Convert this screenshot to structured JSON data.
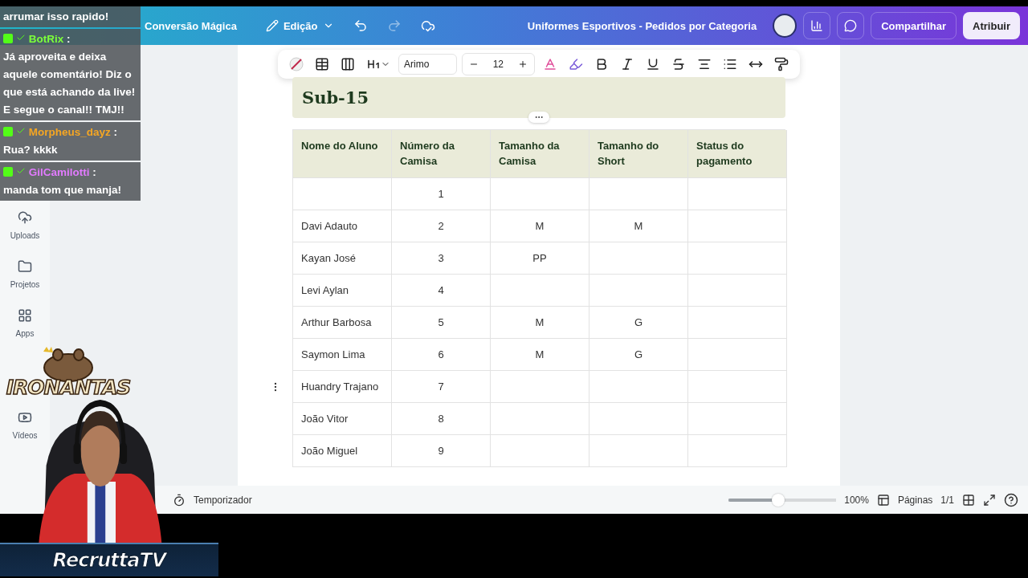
{
  "header": {
    "menu": [
      {
        "label": "Conversão Mágica"
      }
    ],
    "edit_menu": "Edição",
    "redo_disabled": true,
    "title": "Uniformes Esportivos - Pedidos por Categoria",
    "share": "Compartilhar",
    "assign": "Atribuir"
  },
  "sidebar": {
    "items": [
      {
        "kind": "upload",
        "label": "Uploads"
      },
      {
        "kind": "folder",
        "label": "Projetos"
      },
      {
        "kind": "apps",
        "label": "Apps"
      },
      {
        "kind": "video",
        "label": "Vídeos"
      }
    ]
  },
  "toolbar": {
    "font": "Arimo",
    "size": "12"
  },
  "page": {
    "section_title": "Sub-15",
    "table": {
      "columns": [
        "Nome do Aluno",
        "Número da Camisa",
        "Tamanho da Camisa",
        "Tamanho do Short",
        "Status do pagamento"
      ],
      "rows": [
        {
          "cells": [
            "",
            "1",
            "",
            "",
            ""
          ],
          "hovered": false
        },
        {
          "cells": [
            "Davi Adauto",
            "2",
            "M",
            "M",
            ""
          ],
          "hovered": false
        },
        {
          "cells": [
            "Kayan José",
            "3",
            "PP",
            "",
            ""
          ],
          "hovered": false
        },
        {
          "cells": [
            "Levi Aylan",
            "4",
            "",
            "",
            ""
          ],
          "hovered": false
        },
        {
          "cells": [
            "Arthur Barbosa",
            "5",
            "M",
            "G",
            ""
          ],
          "hovered": false
        },
        {
          "cells": [
            "Saymon Lima",
            "6",
            "M",
            "G",
            ""
          ],
          "hovered": false
        },
        {
          "cells": [
            "Huandry Trajano",
            "7",
            "",
            "",
            ""
          ],
          "hovered": true
        },
        {
          "cells": [
            "João Vitor",
            "8",
            "",
            "",
            ""
          ],
          "hovered": false
        },
        {
          "cells": [
            "João Miguel",
            "9",
            "",
            "",
            ""
          ],
          "hovered": false
        }
      ]
    }
  },
  "bottom_bar": {
    "timer": "Temporizador",
    "zoom": {
      "level": 0.46
    },
    "zoom_reading": "100%",
    "pages": "Páginas",
    "page_count": "1/1"
  },
  "chat": [
    {
      "kind": "continuation",
      "text": "arrumar isso rapido!"
    },
    {
      "kind": "message",
      "author": "BotRix",
      "color": "#7cff3a",
      "sep": ":",
      "text": "Já aproveita e deixa aquele comentário! Diz o que está achando da live! E segue o canal!! TMJ!!"
    },
    {
      "kind": "message",
      "author": "Morpheus_dayz",
      "color": "#f5a623",
      "sep": ":",
      "text": "Rua? kkkk"
    },
    {
      "kind": "message",
      "author": "GilCamilotti",
      "color": "#e27bff",
      "sep": ":",
      "text": "manda tom que manja!"
    }
  ],
  "overlay": {
    "logo": "IRONANTAS",
    "banner": "RecruttaTV"
  }
}
